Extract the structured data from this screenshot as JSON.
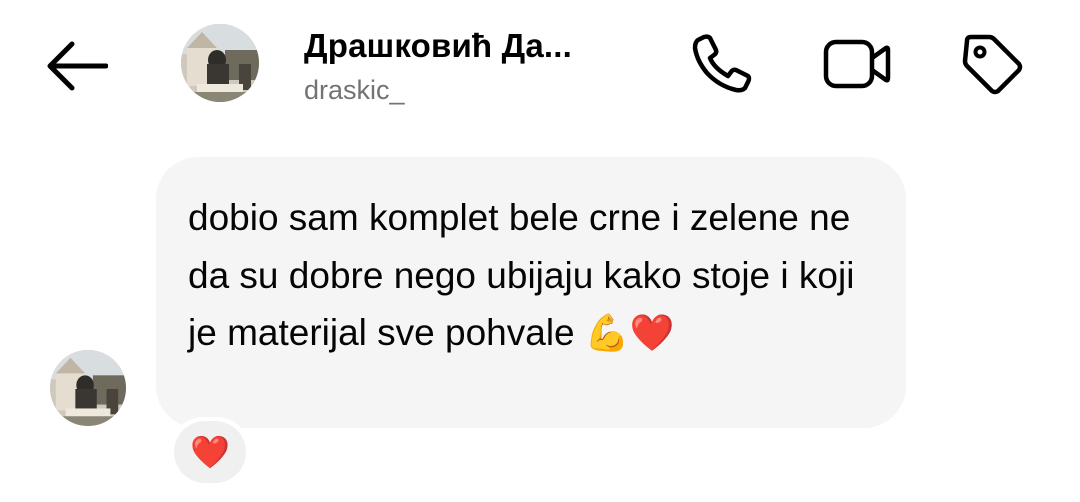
{
  "header": {
    "back_icon": "arrow-left-icon",
    "contact_name": "Драшковић Да...",
    "username": "draskic_",
    "actions": [
      {
        "name": "call",
        "icon": "phone-icon"
      },
      {
        "name": "video-call",
        "icon": "video-camera-icon"
      },
      {
        "name": "tag",
        "icon": "tag-icon"
      }
    ]
  },
  "message": {
    "text": "dobio sam komplet bele crne i zelene ne da su dobre nego ubijaju kako stoje i koji je materijal sve pohvale",
    "emoji": "💪❤️",
    "bubble_color": "#f5f5f5"
  },
  "reaction": {
    "emoji": "❤️"
  }
}
